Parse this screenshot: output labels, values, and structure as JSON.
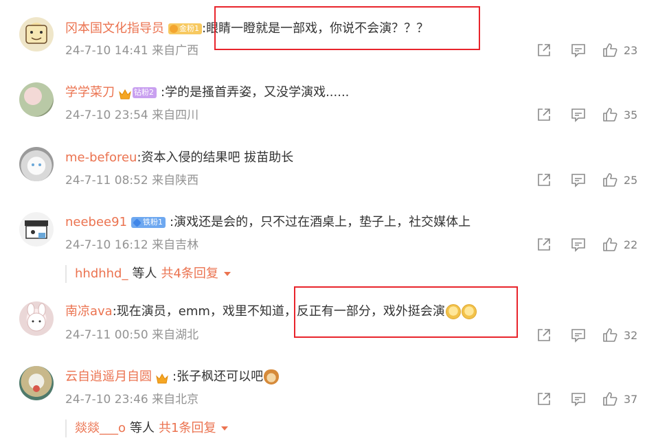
{
  "colors": {
    "username": "#eb7350",
    "meta": "#939393",
    "highlight_box": "#e8242b"
  },
  "comments": [
    {
      "username": "冈本国文化指导员",
      "badge": {
        "type": "gold",
        "label": "金粉1"
      },
      "text": ":眼睛一瞪就是一部戏，你说不会演？？？",
      "meta": "24-7-10 14:41 来自广西",
      "likes": "23",
      "highlighted": true
    },
    {
      "username": "学学菜刀",
      "badge": {
        "type": "diamond",
        "label": "钻粉2"
      },
      "text": ":学的是搔首弄姿，又没学演戏......",
      "meta": "24-7-10 23:54 来自四川",
      "likes": "35"
    },
    {
      "username": "me-beforeu",
      "text": ":资本入侵的结果吧 拔苗助长",
      "meta": "24-7-11 08:52 来自陕西",
      "likes": "25"
    },
    {
      "username": "neebee91",
      "badge": {
        "type": "iron",
        "label": "铁粉1"
      },
      "text": ":演戏还是会的，只不过在酒桌上，垫子上，社交媒体上",
      "meta": "24-7-10 16:12 来自吉林",
      "likes": "22",
      "replies": {
        "names": "hhdhhd_",
        "mid": "等人",
        "total": "共4条回复"
      }
    },
    {
      "username": "南凉ava",
      "text": ":现在演员，emm，戏里不知道，反正有一部分，戏外挺会演",
      "emojis": [
        "dizzy-face-emoji",
        "dizzy-face-emoji"
      ],
      "meta": "24-7-11 00:50 来自湖北",
      "likes": "32",
      "highlighted": true
    },
    {
      "username": "云自逍遥月自圆",
      "crown": true,
      "text": ":张子枫还可以吧",
      "emojis": [
        "cat-face-emoji"
      ],
      "meta": "24-7-10 23:46 来自北京",
      "likes": "37",
      "replies": {
        "names": "燚燚___o",
        "mid": "等人",
        "total": "共1条回复"
      }
    }
  ]
}
